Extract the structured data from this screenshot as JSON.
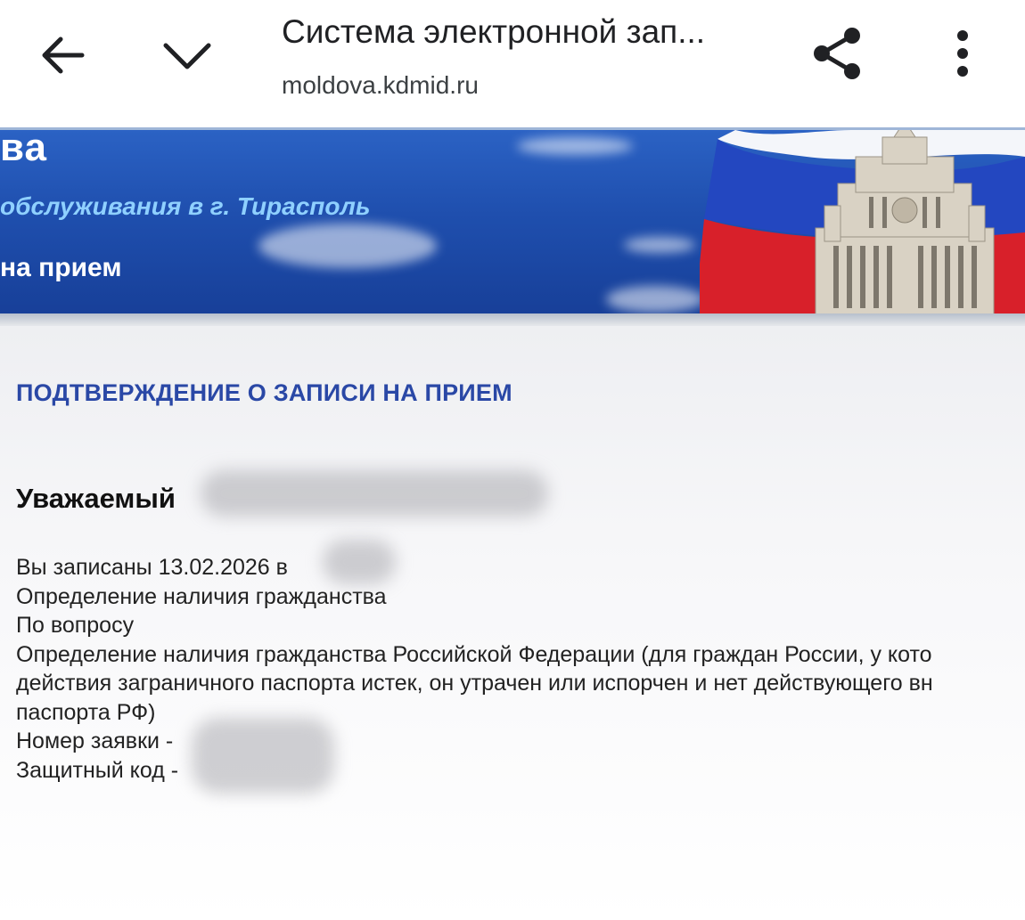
{
  "browser": {
    "title": "Система электронной зап...",
    "url": "moldova.kdmid.ru",
    "icons": {
      "back": "arrow-left-icon",
      "collapse": "chevron-down-icon",
      "share": "share-icon",
      "menu": "more-vertical-icon"
    }
  },
  "banner": {
    "title_fragment": "ва",
    "subtitle": "обслуживания в г. Тирасполь",
    "appointment_label": "на прием",
    "colors": {
      "sky": "#1f4fae",
      "subtitle": "#8fd0ff"
    }
  },
  "confirmation": {
    "heading": "ПОДТВЕРЖДЕНИЕ О ЗАПИСИ НА ПРИЕМ",
    "greeting": "Уважаемый",
    "scheduled": "Вы записаны 13.02.2026 в",
    "service": "Определение наличия гражданства",
    "question_label": "По вопросу",
    "question_text_line1": "Определение наличия гражданства Российской Федерации (для граждан России, у кото",
    "question_text_line2": "действия заграничного паспорта истек, он утрачен или испорчен и нет действующего вн",
    "question_text_line3": "паспорта РФ)",
    "request_number_label": "Номер заявки -",
    "security_code_label": "Защитный код -",
    "heading_color": "#2a48a6"
  }
}
